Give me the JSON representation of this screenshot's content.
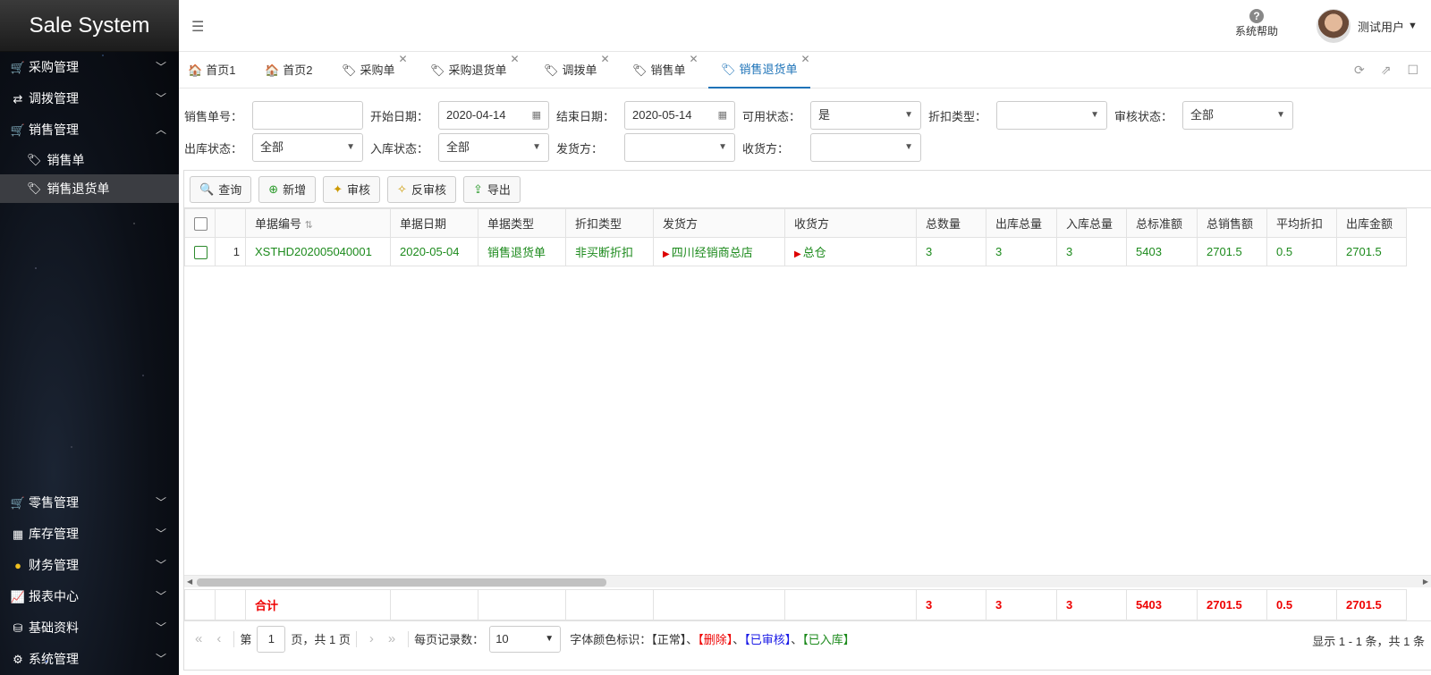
{
  "app": {
    "title": "Sale System"
  },
  "sidebar": {
    "top_items": [
      {
        "label": "采购管理",
        "icon": "cart-icon"
      },
      {
        "label": "调拨管理",
        "icon": "transfer-icon"
      },
      {
        "label": "销售管理",
        "icon": "sales-icon"
      }
    ],
    "sub_items": [
      {
        "label": "销售单"
      },
      {
        "label": "销售退货单"
      }
    ],
    "bottom_items": [
      {
        "label": "零售管理"
      },
      {
        "label": "库存管理"
      },
      {
        "label": "财务管理"
      },
      {
        "label": "报表中心"
      },
      {
        "label": "基础资料"
      },
      {
        "label": "系统管理"
      }
    ]
  },
  "header": {
    "help_label": "系统帮助",
    "user_name": "测试用户"
  },
  "tabs": [
    {
      "label": "首页1",
      "closable": false
    },
    {
      "label": "首页2",
      "closable": false
    },
    {
      "label": "采购单",
      "closable": true
    },
    {
      "label": "采购退货单",
      "closable": true
    },
    {
      "label": "调拨单",
      "closable": true
    },
    {
      "label": "销售单",
      "closable": true
    },
    {
      "label": "销售退货单",
      "closable": true,
      "active": true
    }
  ],
  "filters": {
    "sale_no": {
      "label": "销售单号：",
      "value": ""
    },
    "start_date": {
      "label": "开始日期：",
      "value": "2020-04-14"
    },
    "end_date": {
      "label": "结束日期：",
      "value": "2020-05-14"
    },
    "avail_status": {
      "label": "可用状态：",
      "value": "是"
    },
    "discount_type": {
      "label": "折扣类型：",
      "value": ""
    },
    "audit_status": {
      "label": "审核状态：",
      "value": "全部"
    },
    "out_status": {
      "label": "出库状态：",
      "value": "全部"
    },
    "in_status": {
      "label": "入库状态：",
      "value": "全部"
    },
    "sender": {
      "label": "发货方：",
      "value": ""
    },
    "receiver": {
      "label": "收货方：",
      "value": ""
    }
  },
  "toolbar": {
    "query": "查询",
    "add": "新增",
    "audit": "审核",
    "unaudit": "反审核",
    "export": "导出"
  },
  "table": {
    "headers": [
      "单据编号",
      "单据日期",
      "单据类型",
      "折扣类型",
      "发货方",
      "收货方",
      "总数量",
      "出库总量",
      "入库总量",
      "总标准额",
      "总销售额",
      "平均折扣",
      "出库金额"
    ],
    "rows": [
      {
        "index": "1",
        "cells": [
          "XSTHD202005040001",
          "2020-05-04",
          "销售退货单",
          "非买断折扣",
          "四川经销商总店",
          "总仓",
          "3",
          "3",
          "3",
          "5403",
          "2701.5",
          "0.5",
          "2701.5"
        ]
      }
    ],
    "summary_label": "合计",
    "summary": [
      "3",
      "3",
      "3",
      "5403",
      "2701.5",
      "0.5",
      "2701.5"
    ]
  },
  "pager": {
    "page_prefix": "第",
    "page": "1",
    "page_suffix": "页，共 1 页",
    "per_page_label": "每页记录数：",
    "per_page": "10",
    "legend_label": "字体颜色标识：",
    "legend_normal": "【正常】",
    "legend_deleted": "【删除】",
    "legend_audited": "【已审核】",
    "legend_instock": "【已入库】",
    "sep": "、",
    "info": "显示 1 - 1 条，共 1 条"
  },
  "colors": {
    "accent": "#1e73b8",
    "row_text": "#1c8a1c",
    "summary": "#e00000"
  }
}
